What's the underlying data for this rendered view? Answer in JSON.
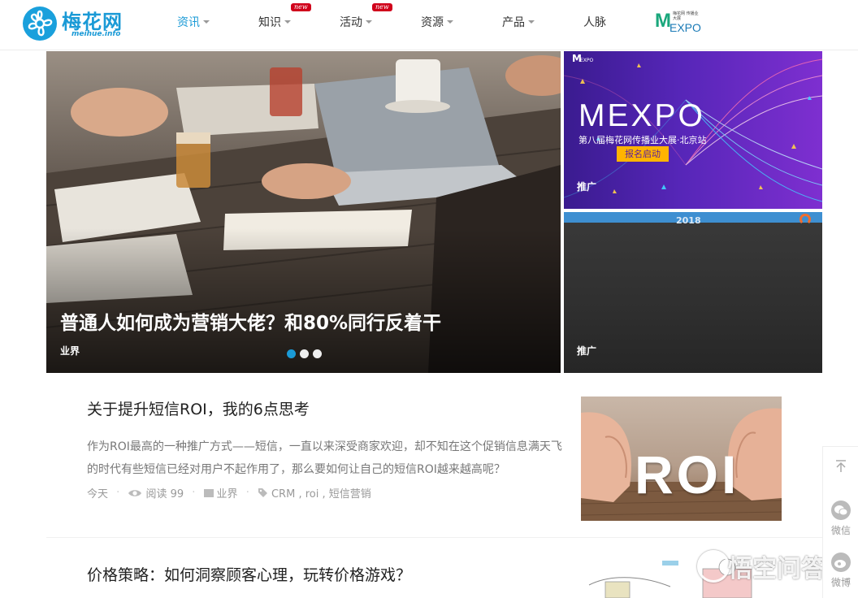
{
  "site": {
    "logo_name": "梅花网",
    "logo_domain": "meihue.info"
  },
  "nav": {
    "items": [
      {
        "label": "资讯",
        "has_caret": true,
        "badge": ""
      },
      {
        "label": "知识",
        "has_caret": true,
        "badge": "new"
      },
      {
        "label": "活动",
        "has_caret": true,
        "badge": "new"
      },
      {
        "label": "资源",
        "has_caret": true,
        "badge": ""
      },
      {
        "label": "产品",
        "has_caret": true,
        "badge": ""
      },
      {
        "label": "人脉",
        "has_caret": false,
        "badge": ""
      }
    ],
    "expo_logo": {
      "m": "M",
      "text": "EXPO",
      "small": "梅花网 传播业大展"
    }
  },
  "hero": {
    "title": "普通人如何成为营销大佬？和80%同行反着干",
    "category": "业界",
    "active_slide": 1,
    "slide_count": 3
  },
  "promos": [
    {
      "tag": "推广",
      "brand_small": "M",
      "brand_small_sub": "EXPO",
      "headline": "MEXPO",
      "subline": "第八届梅花网传播业大展·北京站",
      "button": "报名启动"
    },
    {
      "tag": "推广",
      "year": "2018"
    }
  ],
  "articles": [
    {
      "title": "关于提升短信ROI，我的6点思考",
      "excerpt": "作为ROI最高的一种推广方式——短信，一直以来深受商家欢迎，却不知在这个促销信息满天飞的时代有些短信已经对用户不起作用了，那么要如何让自己的短信ROI越来越高呢？",
      "date": "今天",
      "reads": "阅读 99",
      "category": "业界",
      "tags": "CRM , roi , 短信营销",
      "thumb_text": "ROI"
    },
    {
      "title": "价格策略：如何洞察顾客心理，玩转价格游戏？"
    }
  ],
  "float_bar": {
    "wechat": "微信",
    "weibo": "微博"
  },
  "watermark": "悟空问答",
  "colors": {
    "brand": "#1a9ad6",
    "badge": "#d0021b",
    "expo_green": "#1aa77c",
    "promo_purple": "#5626b8",
    "button_yellow": "#ffb400"
  }
}
